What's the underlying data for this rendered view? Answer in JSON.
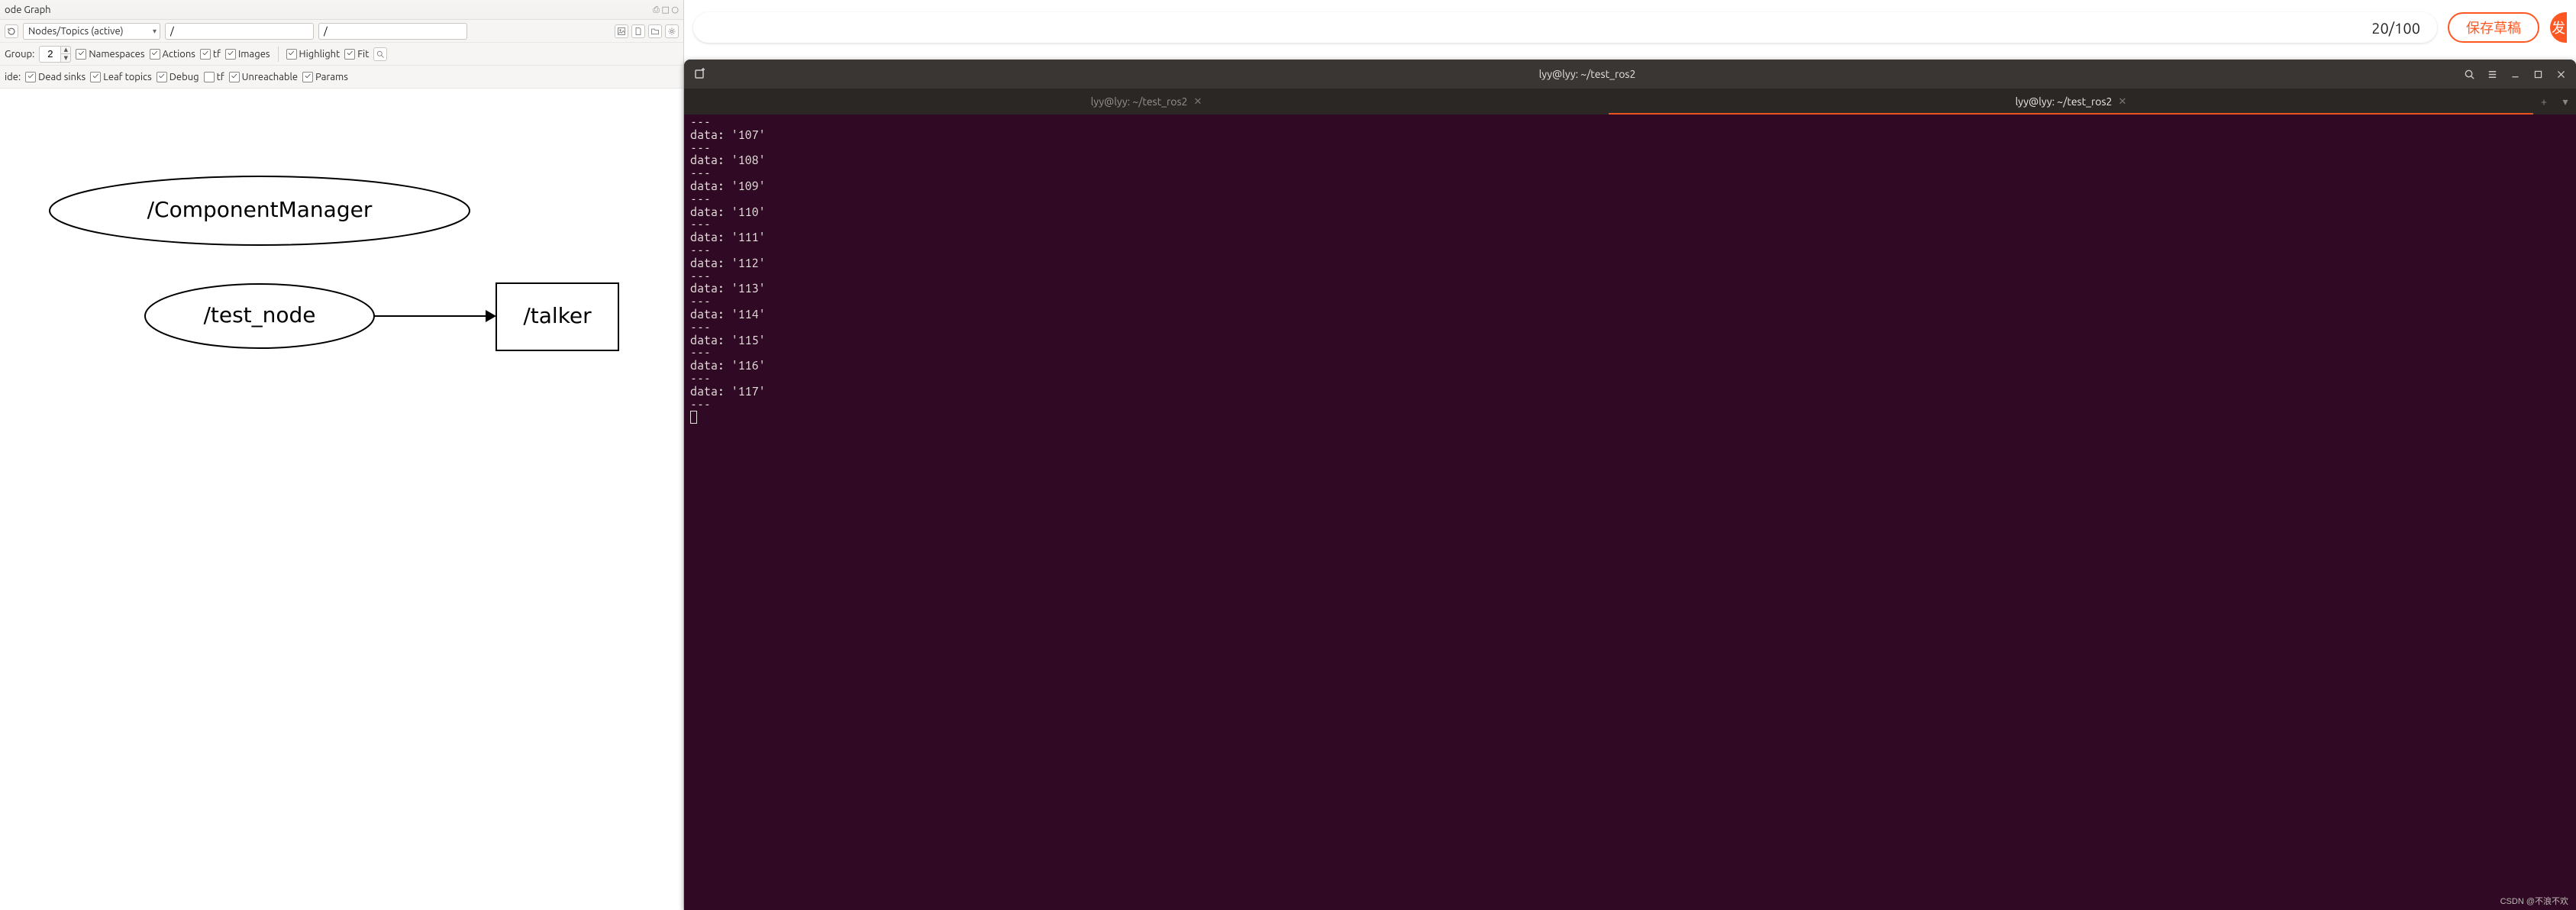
{
  "left": {
    "window_title": "ode Graph",
    "winflags": "⎙ □ ○",
    "refresh_icon": "refresh-icon",
    "mode_dropdown": "Nodes/Topics (active)",
    "path1": "/",
    "path2": "/",
    "group_label": "Group:",
    "group_value": "2",
    "checks_row1": {
      "namespaces": "Namespaces",
      "actions": "Actions",
      "tf": "tf",
      "images": "Images",
      "highlight": "Highlight",
      "fit": "Fit"
    },
    "hide_label": "ide:",
    "checks_row2": {
      "dead_sinks": "Dead sinks",
      "leaf_topics": "Leaf topics",
      "debug": "Debug",
      "tf": "tf",
      "unreachable": "Unreachable",
      "params": "Params"
    },
    "nodes": {
      "component_manager": "/ComponentManager",
      "test_node": "/test_node",
      "talker": "/talker"
    }
  },
  "right": {
    "counter": "20/100",
    "draft_btn": "保存草稿",
    "publish_btn": "发",
    "term_title": "lyy@lyy: ~/test_ros2",
    "tab1": "lyy@lyy: ~/test_ros2",
    "tab2": "lyy@lyy: ~/test_ros2",
    "output": [
      "---",
      "data: '107'",
      "---",
      "data: '108'",
      "---",
      "data: '109'",
      "---",
      "data: '110'",
      "---",
      "data: '111'",
      "---",
      "data: '112'",
      "---",
      "data: '113'",
      "---",
      "data: '114'",
      "---",
      "data: '115'",
      "---",
      "data: '116'",
      "---",
      "data: '117'",
      "---"
    ]
  },
  "watermark": "CSDN @不浪不欢"
}
